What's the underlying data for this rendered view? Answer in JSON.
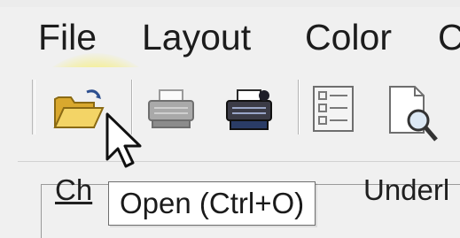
{
  "menu": {
    "items": [
      {
        "label": "File"
      },
      {
        "label": "Layout"
      },
      {
        "label": "Color"
      },
      {
        "label": "C"
      }
    ]
  },
  "toolbar": {
    "buttons": [
      {
        "icon": "open-folder-icon"
      },
      {
        "icon": "print-icon"
      },
      {
        "icon": "print-setup-icon"
      },
      {
        "icon": "form-list-icon"
      },
      {
        "icon": "print-preview-icon"
      }
    ]
  },
  "panel": {
    "tab_left": "Ch",
    "tab_right": "Underl"
  },
  "tooltip": {
    "text": "Open (Ctrl+O)"
  },
  "colors": {
    "highlight": "#f6ee6e",
    "chrome": "#f0f0f0",
    "folder": "#e8c04a"
  }
}
